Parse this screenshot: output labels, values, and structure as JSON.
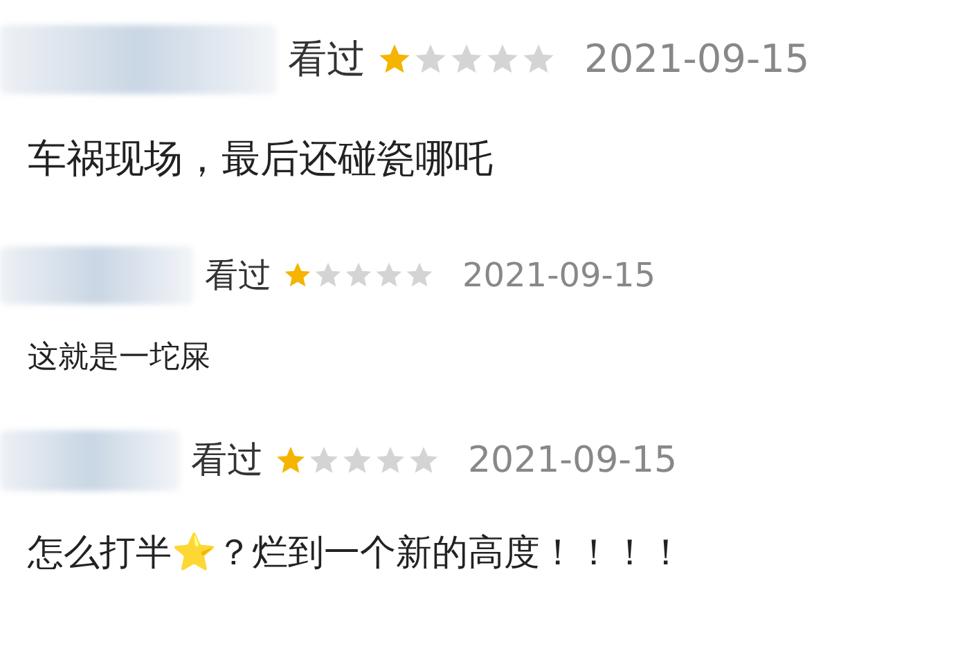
{
  "reviews": [
    {
      "status": "看过",
      "stars": 1,
      "date": "2021-09-15",
      "text": "车祸现场，最后还碰瓷哪吒"
    },
    {
      "status": "看过",
      "stars": 1,
      "date": "2021-09-15",
      "text": "这就是一坨屎"
    },
    {
      "status": "看过",
      "stars": 1,
      "date": "2021-09-15",
      "text": "怎么打半⭐？烂到一个新的高度！！！！"
    }
  ]
}
